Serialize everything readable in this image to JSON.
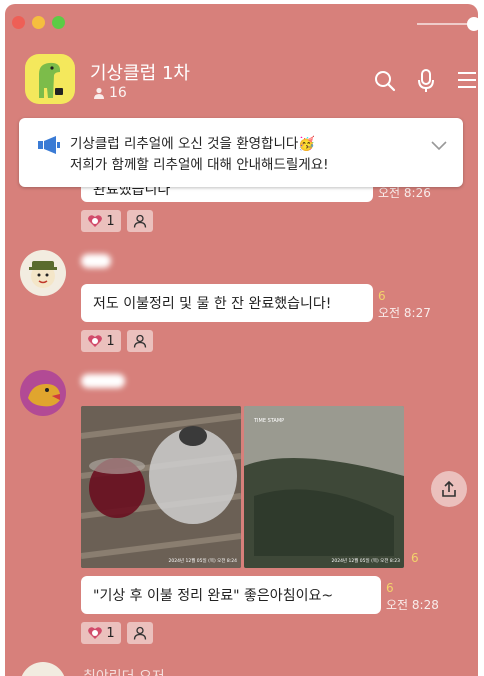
{
  "window": {
    "traffic_lights": [
      "#ee5f56",
      "#f5be3f",
      "#5ccb45"
    ]
  },
  "header": {
    "room_title": "기상클럽 1차",
    "member_count": "16",
    "icons": [
      "search-icon",
      "mic-icon",
      "menu-icon"
    ]
  },
  "notice": {
    "line1": "기상클럽 리추얼에 오신 것을 환영합니다🥳",
    "line2": "저희가 함께할 리추얼에 대해 안내해드릴게요!"
  },
  "messages": [
    {
      "text": "완료했습니다",
      "unread": "",
      "time": "오전 8:26",
      "reaction_count": "1"
    },
    {
      "text": "저도 이불정리 및 물 한 잔 완료했습니다!",
      "unread": "6",
      "time": "오전 8:27",
      "reaction_count": "1"
    },
    {
      "photo1_stamp": "2024년 12월 05일 (목) 오전 8:24",
      "photo2_brand": "TIME STAMP",
      "photo2_stamp": "2024년 12월 05일 (목) 오전 8:23",
      "photos_unread": "6",
      "text": "\"기상 후 이불 정리 완료\"  좋은아침이요~",
      "unread": "6",
      "time": "오전 8:28",
      "reaction_count": "1"
    }
  ],
  "next_sender_partial": "취야린더 오저",
  "colors": {
    "chat_background": "#d7807b",
    "unread_color": "#f2d36b",
    "notice_icon": "#3a7bd5"
  }
}
